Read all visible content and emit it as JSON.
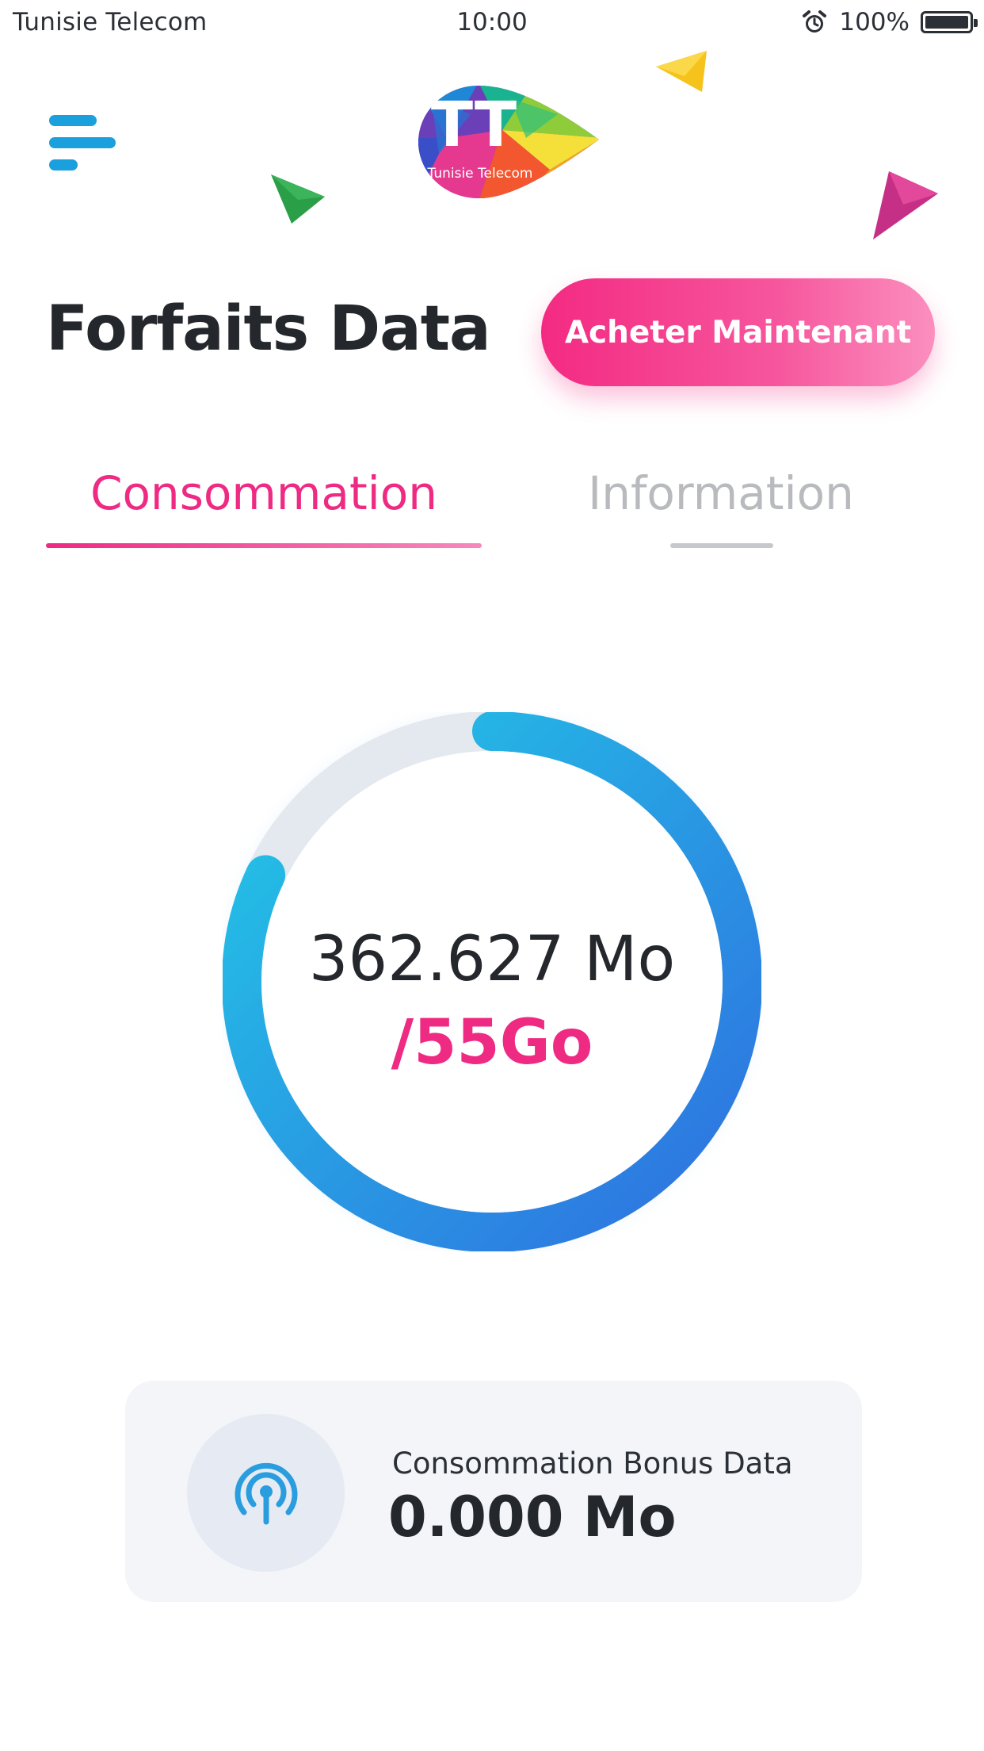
{
  "status_bar": {
    "carrier": "Tunisie Telecom",
    "time": "10:00",
    "battery": "100%",
    "icons": [
      "alarm-icon",
      "battery-icon"
    ]
  },
  "header": {
    "logo_text": "Tunisie Telecom",
    "logo_letters": "TT",
    "menu_icon": "menu-icon"
  },
  "page": {
    "title": "Forfaits Data",
    "buy_button_label": "Acheter Maintenant"
  },
  "tabs": [
    {
      "label": "Consommation",
      "active": true
    },
    {
      "label": "Information",
      "active": false
    }
  ],
  "gauge": {
    "used": "362.627 Mo",
    "total": "/55Go",
    "progress_fraction": 0.82
  },
  "bonus": {
    "label": "Consommation Bonus Data",
    "value": "0.000 Mo",
    "icon": "broadcast-icon"
  },
  "colors": {
    "accent_pink": "#ee2a83",
    "accent_blue": "#1aa0dc",
    "gauge_start": "#2f6fe0",
    "gauge_end": "#22c4e8"
  }
}
